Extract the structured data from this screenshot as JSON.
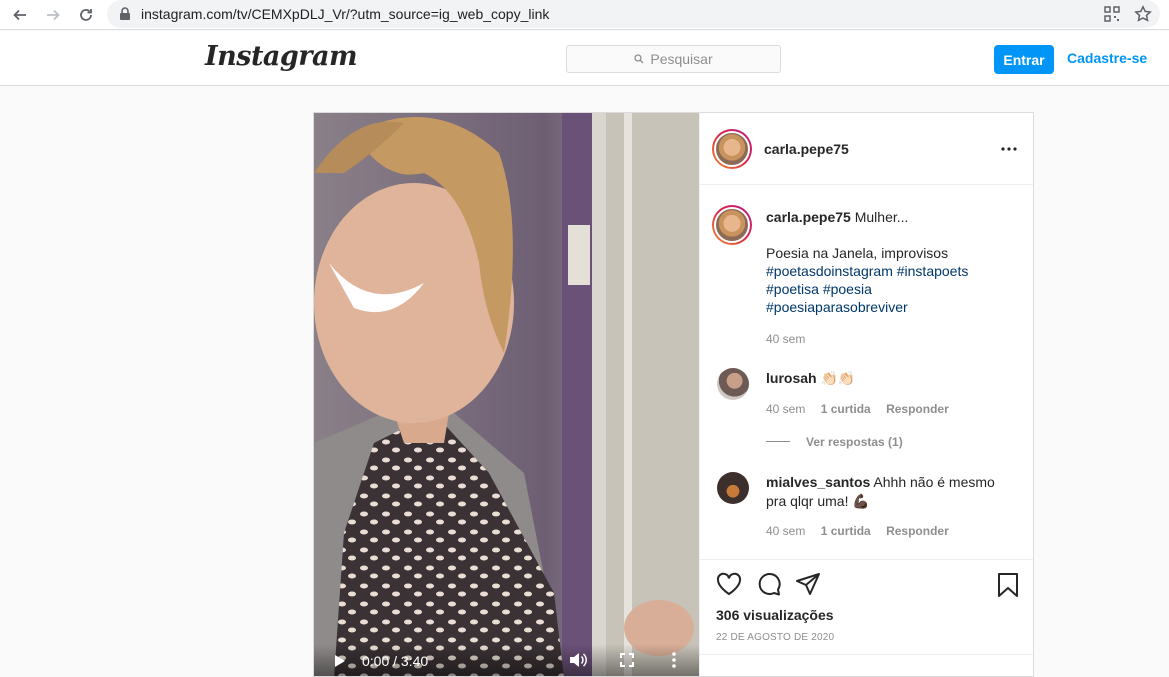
{
  "browser": {
    "url": "instagram.com/tv/CEMXpDLJ_Vr/?utm_source=ig_web_copy_link"
  },
  "header": {
    "logo": "Instagram",
    "search_placeholder": "Pesquisar",
    "login_label": "Entrar",
    "signup_label": "Cadastre-se"
  },
  "post": {
    "username": "carla.pepe75",
    "video": {
      "time": "0:00 / 3:40"
    },
    "caption": {
      "username": "carla.pepe75",
      "first_line": "Mulher...",
      "text": "Poesia na Janela, improvisos",
      "hashtags_line1": "#poetasdoinstagram #instapoets",
      "hashtags_line2": "#poetisa #poesia",
      "hashtags_line3": "#poesiaparasobreviver",
      "age": "40 sem"
    },
    "comments": [
      {
        "username": "lurosah",
        "text": "👏🏻👏🏻",
        "age": "40 sem",
        "likes": "1 curtida",
        "reply": "Responder",
        "view_replies": "Ver respostas (1)"
      },
      {
        "username": "mialves_santos",
        "text": "Ahhh não é mesmo pra qlqr uma! 💪🏿",
        "age": "40 sem",
        "likes": "1 curtida",
        "reply": "Responder"
      }
    ],
    "views": "306 visualizações",
    "date": "22 DE AGOSTO DE 2020"
  },
  "colors": {
    "accent": "#0095f6",
    "hashtag": "#00376b",
    "muted": "#8e8e8e",
    "border": "#dbdbdb"
  }
}
